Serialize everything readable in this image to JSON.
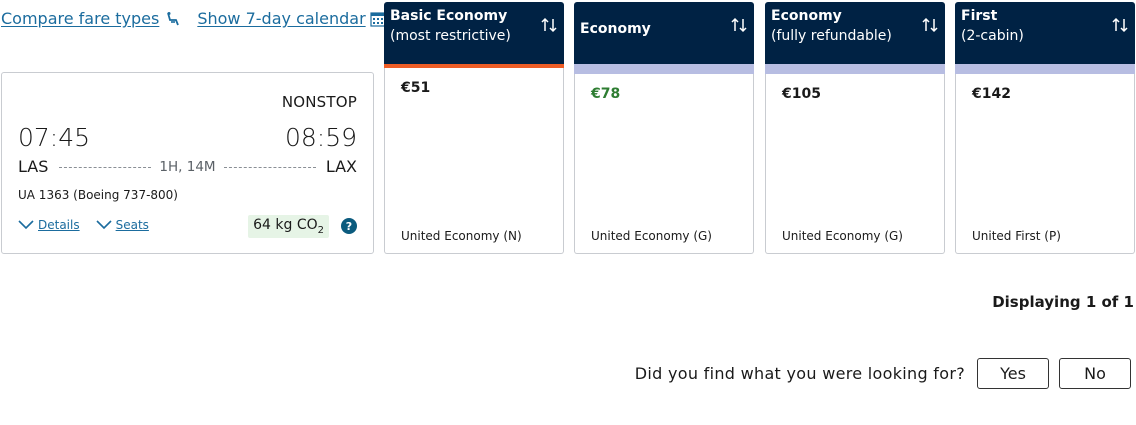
{
  "top_links": {
    "compare_label": "Compare fare types",
    "calendar_label": "Show 7-day calendar"
  },
  "flight": {
    "stops": "NONSTOP",
    "departure_time": "07:45",
    "arrival_time": "08:59",
    "origin": "LAS",
    "destination": "LAX",
    "duration": "1H, 14M",
    "flight_info": "UA 1363 (Boeing 737-800)",
    "details_label": "Details",
    "seats_label": "Seats",
    "co2_value": "64 kg CO",
    "co2_sub": "2",
    "help_label": "?"
  },
  "fares": [
    {
      "name": "Basic Economy",
      "subtitle": "(most restrictive)",
      "price": "€51",
      "cabin": "United Economy (N)"
    },
    {
      "name": "Economy",
      "subtitle": "",
      "price": "€78",
      "cabin": "United Economy (G)"
    },
    {
      "name": "Economy",
      "subtitle": "(fully refundable)",
      "price": "€105",
      "cabin": "United Economy (G)"
    },
    {
      "name": "First",
      "subtitle": "(2-cabin)",
      "price": "€142",
      "cabin": "United First (P)"
    }
  ],
  "results": {
    "displaying": "Displaying 1 of 1"
  },
  "feedback": {
    "question": "Did you find what you were looking for?",
    "yes_label": "Yes",
    "no_label": "No"
  },
  "colors": {
    "header_navy": "#002244",
    "accent_orange": "#ee5d26",
    "bar_lavender": "#b7bde2",
    "link_blue": "#1b6c9e",
    "lowest_price_green": "#2e7d32",
    "co2_badge_bg": "#e6f4e6"
  }
}
